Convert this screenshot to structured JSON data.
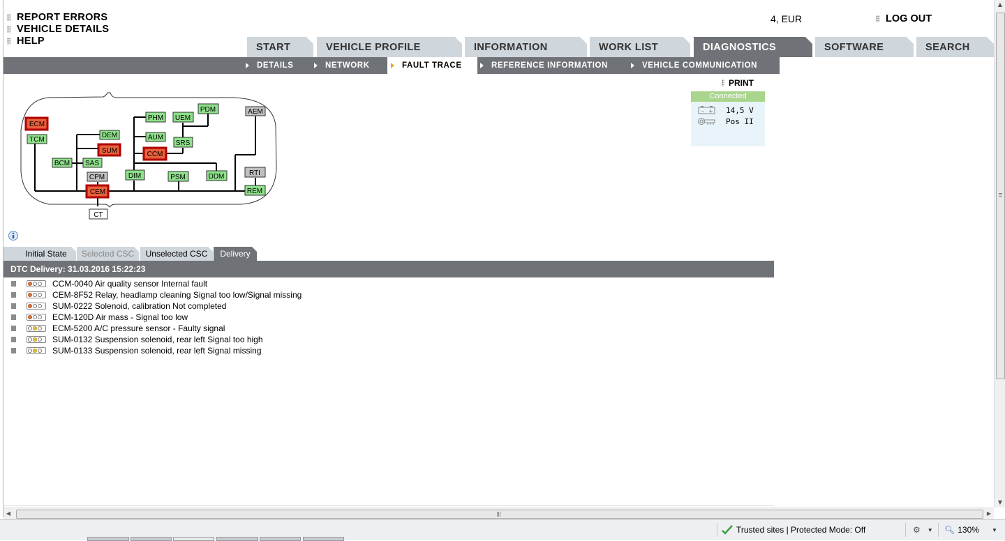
{
  "top_menu": [
    {
      "label": "REPORT ERRORS"
    },
    {
      "label": "VEHICLE DETAILS"
    },
    {
      "label": "HELP"
    }
  ],
  "currency": "4, EUR",
  "logout_label": "LOG OUT",
  "main_tabs": [
    {
      "label": "START"
    },
    {
      "label": "VEHICLE PROFILE"
    },
    {
      "label": "INFORMATION"
    },
    {
      "label": "WORK LIST"
    },
    {
      "label": "DIAGNOSTICS"
    },
    {
      "label": "SOFTWARE"
    },
    {
      "label": "SEARCH"
    }
  ],
  "active_tab": "DIAGNOSTICS",
  "sub_tabs": [
    {
      "label": "DETAILS"
    },
    {
      "label": "NETWORK"
    },
    {
      "label": "FAULT TRACE"
    },
    {
      "label": "REFERENCE INFORMATION"
    },
    {
      "label": "VEHICLE COMMUNICATION"
    }
  ],
  "active_sub_tab": "FAULT TRACE",
  "print_label": "PRINT",
  "connection": {
    "status": "Connected",
    "voltage": "14,5 V",
    "ignition": "Pos II",
    "status_color": "#a9d58c"
  },
  "modules": {
    "ECM": "ECM",
    "TCM": "TCM",
    "DEM": "DEM",
    "SUM": "SUM",
    "BCM": "BCM",
    "SAS": "SAS",
    "CPM": "CPM",
    "CEM": "CEM",
    "CT": "CT",
    "PHM": "PHM",
    "AUM": "AUM",
    "CCM": "CCM",
    "DIM": "DIM",
    "UEM": "UEM",
    "SRS": "SRS",
    "PDM": "PDM",
    "PSM": "PSM",
    "DDM": "DDM",
    "AEM": "AEM",
    "RTI": "RTI",
    "REM": "REM"
  },
  "module_colors": {
    "fault": "#e8603c",
    "ok": "#8ee08a",
    "inactive": "#c0c0c0",
    "none": "#ffffff"
  },
  "dtc_tabs": [
    {
      "label": "Initial State"
    },
    {
      "label": "Selected CSC"
    },
    {
      "label": "Unselected CSC"
    },
    {
      "label": "Delivery"
    }
  ],
  "active_dtc_tab": "Delivery",
  "dtc_header": "DTC Delivery: 31.03.2016 15:22:23",
  "dtcs": [
    {
      "text": "CCM-0040 Air quality sensor Internal fault",
      "light": "orange"
    },
    {
      "text": "CEM-8F52 Relay, headlamp cleaning Signal too low/Signal missing",
      "light": "orange"
    },
    {
      "text": "SUM-0222 Solenoid, calibration Not completed",
      "light": "orange"
    },
    {
      "text": "ECM-120D Air mass - Signal too low",
      "light": "orange"
    },
    {
      "text": "ECM-5200 A/C pressure sensor - Faulty signal",
      "light": "yellow"
    },
    {
      "text": "SUM-0132 Suspension solenoid, rear left Signal too high",
      "light": "yellow"
    },
    {
      "text": "SUM-0133 Suspension solenoid, rear left Signal missing",
      "light": "yellow"
    }
  ],
  "status_bar": {
    "zone": "Trusted sites | Protected Mode: Off",
    "zoom": "130%"
  }
}
